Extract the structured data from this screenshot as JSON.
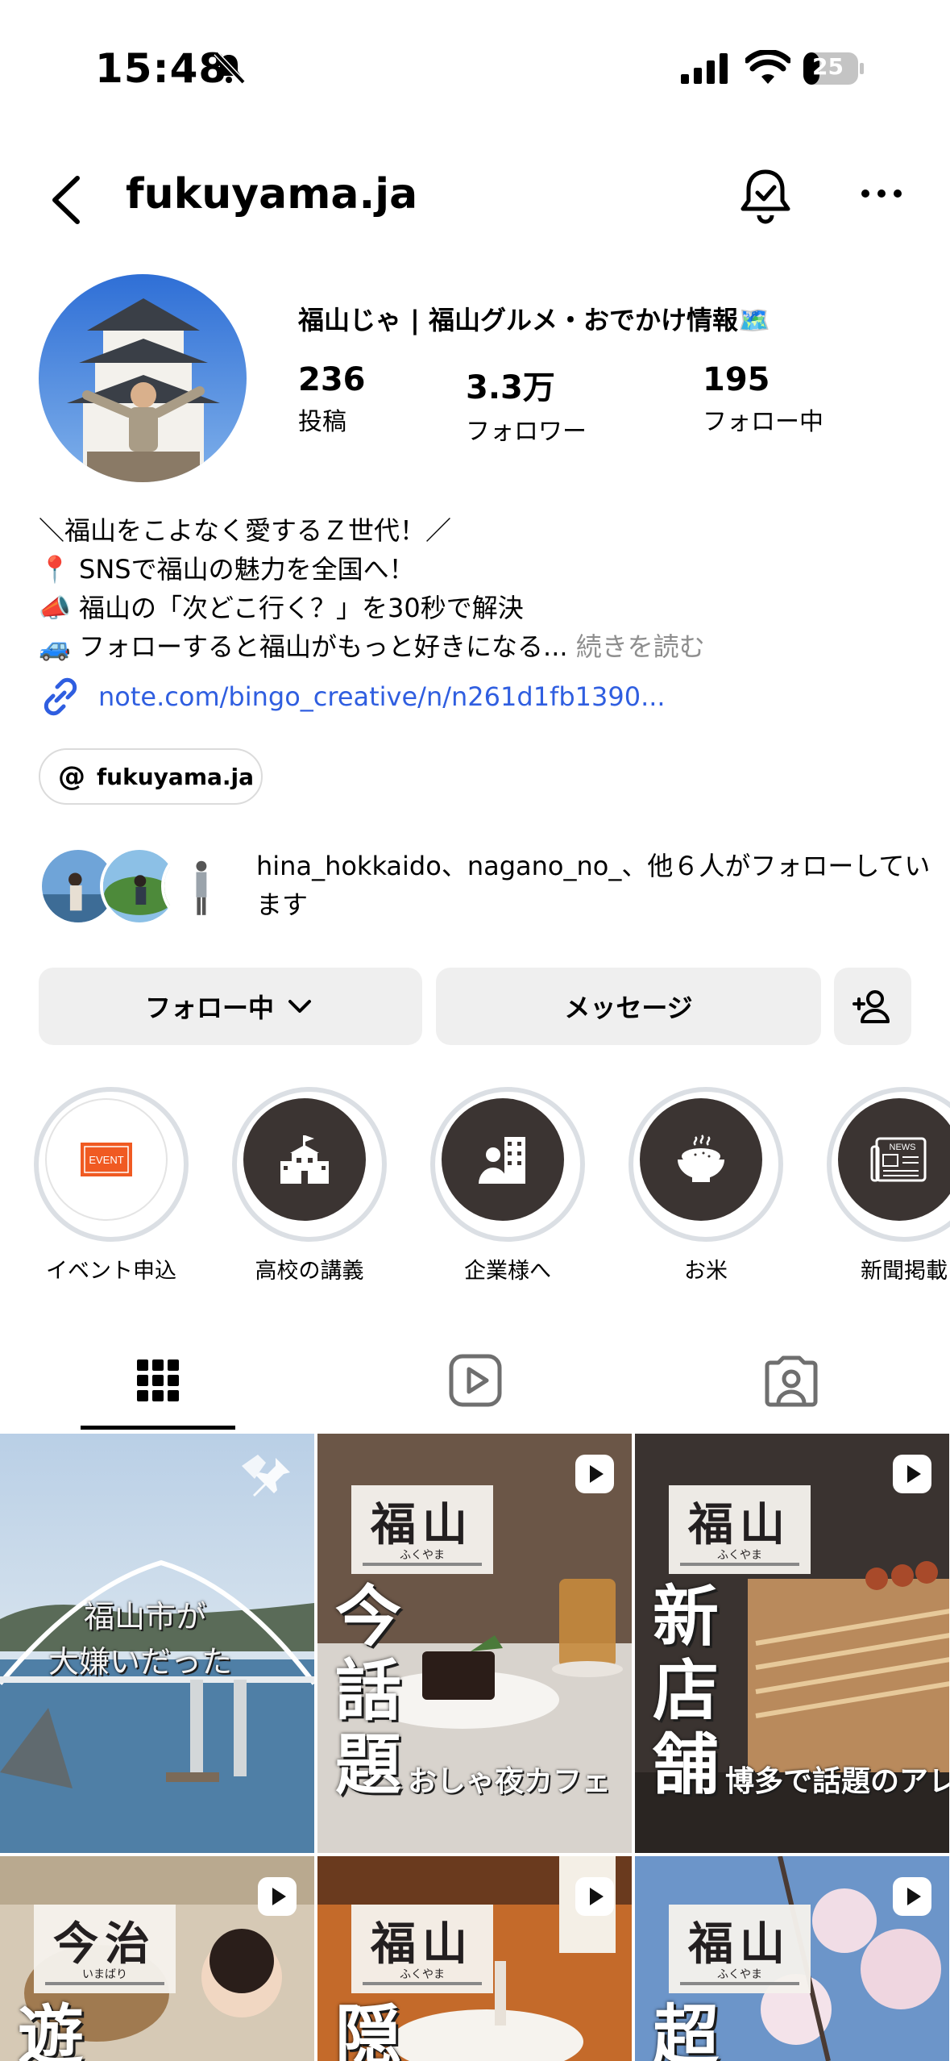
{
  "status_bar": {
    "time": "15:48",
    "battery": "25"
  },
  "header": {
    "username": "fukuyama.ja"
  },
  "profile": {
    "display_name": "福山じゃ | 福山グルメ・おでかけ情報🗺️",
    "stats": [
      {
        "value": "236",
        "label": "投稿"
      },
      {
        "value": "3.3万",
        "label": "フォロワー"
      },
      {
        "value": "195",
        "label": "フォロー中"
      }
    ],
    "bio": [
      "＼福山をこよなく愛するＺ世代！／",
      "📍 SNSで福山の魅力を全国へ！",
      "📣 福山の「次どこ行く？」を30秒で解決",
      "🚙 フォローすると福山がもっと好きになる..."
    ],
    "bio_more": "続きを読む",
    "link": "note.com/bingo_creative/n/n261d1fb1390...",
    "threads_handle": "fukuyama.ja",
    "followed_by": "hina_hokkaido、nagano_no_、他６人がフォローしています"
  },
  "actions": {
    "following": "フォロー中",
    "message": "メッセージ"
  },
  "highlights": [
    {
      "label": "イベント申込",
      "icon": "event-icon"
    },
    {
      "label": "高校の講義",
      "icon": "school-icon"
    },
    {
      "label": "企業様へ",
      "icon": "business-icon"
    },
    {
      "label": "お米",
      "icon": "rice-bowl-icon"
    },
    {
      "label": "新聞掲載",
      "icon": "newspaper-icon"
    }
  ],
  "tabs": [
    "posts-grid-icon",
    "reels-icon",
    "tagged-icon"
  ],
  "grid": {
    "post1": {
      "text1": "福山市が",
      "text2": "大嫌いだった"
    },
    "post2": {
      "tag": "福山",
      "tag_kana": "ふくやま",
      "vertical": "今話題",
      "caption": "おしゃ夜カフェ"
    },
    "post3": {
      "tag": "福山",
      "tag_kana": "ふくやま",
      "vertical": "新店舗",
      "caption": "博多で話題のアレ"
    },
    "post4": {
      "tag": "今治",
      "tag_kana": "いまばり",
      "vertical": "遊"
    },
    "post5": {
      "tag": "福山",
      "tag_kana": "ふくやま",
      "vertical": "隠"
    },
    "post6": {
      "tag": "福山",
      "tag_kana": "ふくやま",
      "vertical": "超"
    }
  },
  "colors": {
    "link": "#2f5ee0",
    "button_bg": "#efefef",
    "highlight_bg": "#3b3432",
    "event_orange": "#f05a22"
  }
}
